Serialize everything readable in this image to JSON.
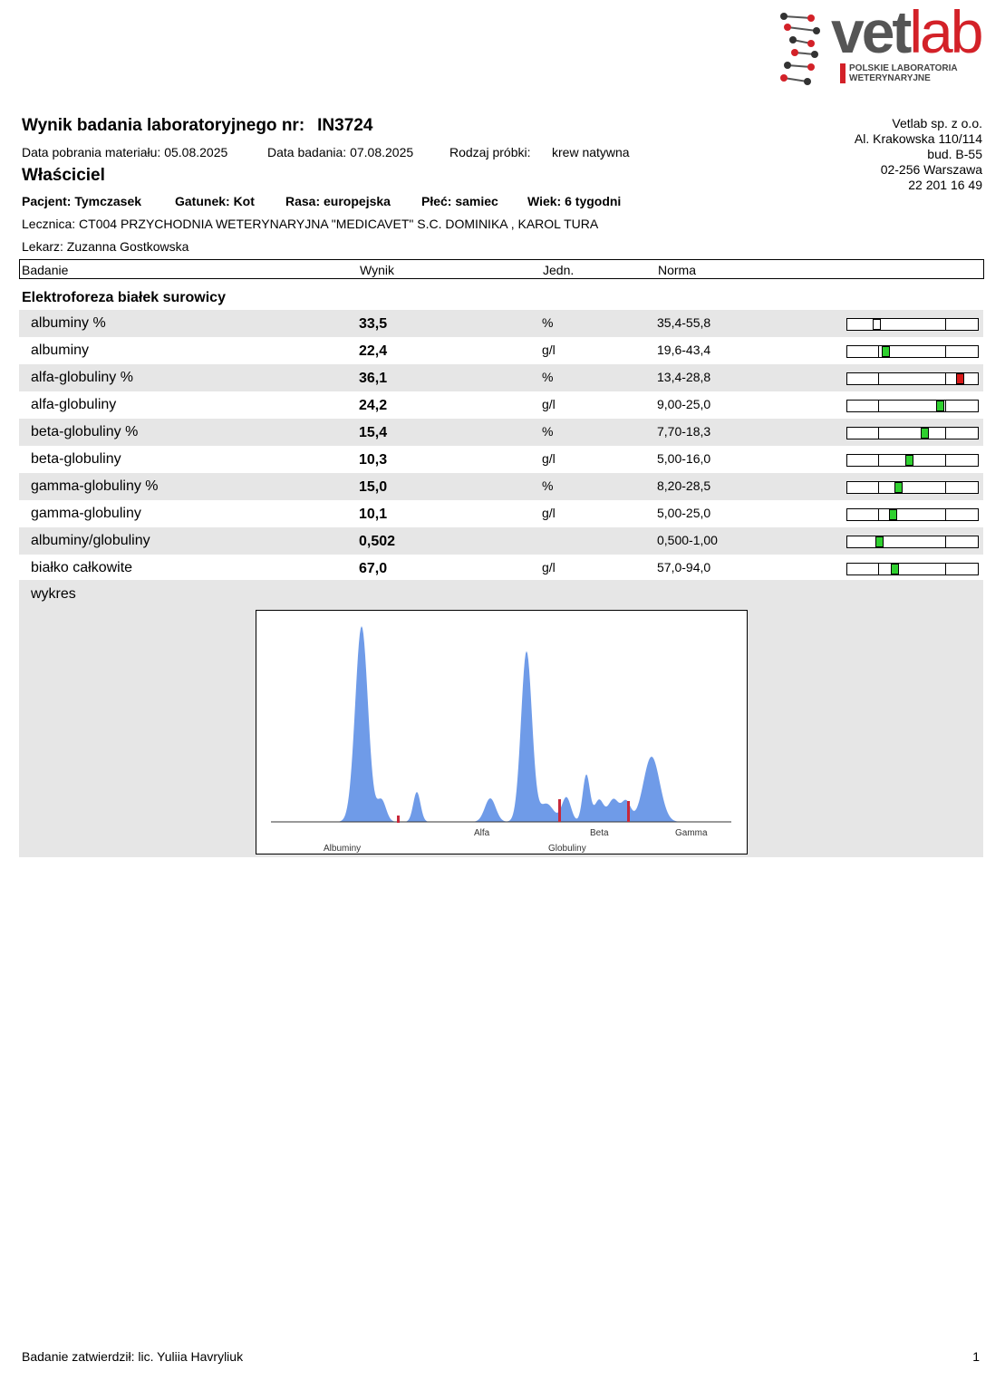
{
  "logo": {
    "word_a": "vet",
    "word_b": "lab",
    "sub_line1": "POLSKIE LABORATORIA",
    "sub_line2": "WETERYNARYJNE"
  },
  "header": {
    "title": "Wynik badania laboratoryjnego nr:",
    "number": "IN3724",
    "collection_date": "Data pobrania materiału: 05.08.2025",
    "test_date": "Data badania: 07.08.2025",
    "sample_type_label": "Rodzaj próbki:",
    "sample_type": "krew natywna",
    "owner": "Właściciel",
    "patient": "Pacjent: Tymczasek",
    "species": "Gatunek: Kot",
    "breed": "Rasa: europejska",
    "sex": "Płeć: samiec",
    "age": "Wiek: 6 tygodni",
    "clinic": "Lecznica:  CT004 PRZYCHODNIA WETERYNARYJNA \"MEDICAVET\" S.C. DOMINIKA , KAROL TURA",
    "doctor": "Lekarz: Zuzanna Gostkowska"
  },
  "company": {
    "name": "Vetlab sp. z o.o.",
    "street": "Al. Krakowska 110/114",
    "building": "bud. B-55",
    "city": "02-256 Warszawa",
    "phone": "22 201 16 49"
  },
  "table": {
    "col_test": "Badanie",
    "col_result": "Wynik",
    "col_unit": "Jedn.",
    "col_norm": "Norma",
    "section": "Elektroforeza białek surowicy",
    "rows": [
      {
        "name": "albuminy %",
        "value": "33,5",
        "unit": "%",
        "norm": "35,4-55,8",
        "pos": 0.22,
        "status": "low",
        "color": "#ffffff"
      },
      {
        "name": "albuminy",
        "value": "22,4",
        "unit": "g/l",
        "norm": "19,6-43,4",
        "pos": 0.29,
        "status": "normal",
        "color": "#2fd02f"
      },
      {
        "name": "alfa-globuliny %",
        "value": "36,1",
        "unit": "%",
        "norm": "13,4-28,8",
        "pos": 0.86,
        "status": "high",
        "color": "#d81818"
      },
      {
        "name": "alfa-globuliny",
        "value": "24,2",
        "unit": "g/l",
        "norm": "9,00-25,0",
        "pos": 0.71,
        "status": "normal",
        "color": "#2fd02f"
      },
      {
        "name": "beta-globuliny %",
        "value": "15,4",
        "unit": "%",
        "norm": "7,70-18,3",
        "pos": 0.59,
        "status": "normal",
        "color": "#2fd02f"
      },
      {
        "name": "beta-globuliny",
        "value": "10,3",
        "unit": "g/l",
        "norm": "5,00-16,0",
        "pos": 0.47,
        "status": "normal",
        "color": "#2fd02f"
      },
      {
        "name": "gamma-globuliny %",
        "value": "15,0",
        "unit": "%",
        "norm": "8,20-28,5",
        "pos": 0.39,
        "status": "normal",
        "color": "#2fd02f"
      },
      {
        "name": "gamma-globuliny",
        "value": "10,1",
        "unit": "g/l",
        "norm": "5,00-25,0",
        "pos": 0.35,
        "status": "normal",
        "color": "#2fd02f"
      },
      {
        "name": "albuminy/globuliny",
        "value": "0,502",
        "unit": "",
        "norm": "0,500-1,00",
        "pos": 0.24,
        "status": "normal",
        "color": "#2fd02f"
      },
      {
        "name": "białko całkowite",
        "value": "67,0",
        "unit": "g/l",
        "norm": "57,0-94,0",
        "pos": 0.36,
        "status": "normal",
        "color": "#2fd02f"
      }
    ]
  },
  "chart": {
    "label": "wykres",
    "fill_color": "#6f9be8",
    "divider_color": "#c8283a",
    "labels_top": [
      "Alfa",
      "Beta",
      "Gamma"
    ],
    "labels_bottom": [
      "Albuminy",
      "Globuliny"
    ]
  },
  "footer": {
    "approved": "Badanie zatwierdził: lic. Yuliia Havryliuk",
    "page": "1"
  }
}
